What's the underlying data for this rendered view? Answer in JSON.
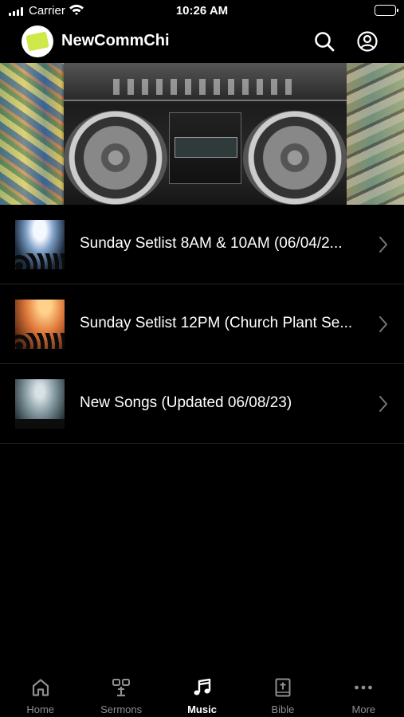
{
  "status_bar": {
    "carrier": "Carrier",
    "time": "10:26 AM"
  },
  "header": {
    "title": "NewCommChi"
  },
  "list": {
    "items": [
      {
        "title": "Sunday Setlist 8AM & 10AM  (06/04/2..."
      },
      {
        "title": "Sunday Setlist 12PM (Church Plant Se..."
      },
      {
        "title": "New Songs (Updated 06/08/23)"
      }
    ]
  },
  "tabs": [
    {
      "label": "Home",
      "icon": "home-icon"
    },
    {
      "label": "Sermons",
      "icon": "sermons-icon"
    },
    {
      "label": "Music",
      "icon": "music-icon",
      "active": true
    },
    {
      "label": "Bible",
      "icon": "bible-icon"
    },
    {
      "label": "More",
      "icon": "more-icon"
    }
  ],
  "colors": {
    "background": "#000000",
    "text": "#ffffff",
    "inactive_tab": "#8e8e93",
    "divider": "#222222"
  }
}
